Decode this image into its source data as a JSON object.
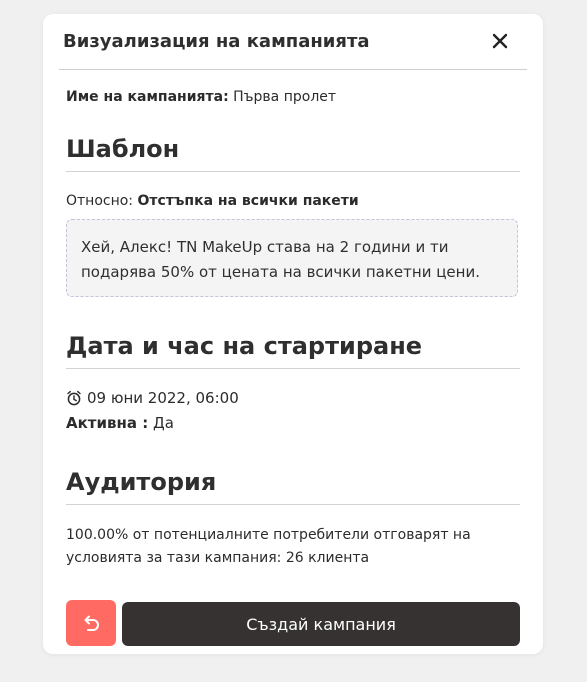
{
  "modal": {
    "title": "Визуализация на кампанията",
    "close_icon": "close-icon"
  },
  "campaign": {
    "name_label": "Име на кампанията:",
    "name_value": "Първа пролет"
  },
  "template": {
    "heading": "Шаблон",
    "about_label": "Относно:",
    "about_value": "Отстъпка на всички пакети",
    "message": "Хей, Алекс! TN MakeUp става на 2 години и ти подарява 50% от цената на всички пакетни цени."
  },
  "start": {
    "heading": "Дата и час на стартиране",
    "clock_icon": "alarm-clock-icon",
    "datetime": "09 юни 2022, 06:00",
    "active_label": "Активна :",
    "active_value": "Да"
  },
  "audience": {
    "heading": "Аудитория",
    "description": "100.00% от потенциалните потребители отговарят на условията за тази кампания: 26 клиента"
  },
  "actions": {
    "back_icon": "undo-arrow-icon",
    "create_label": "Създай кампания"
  },
  "colors": {
    "back_button": "#ff6b63",
    "create_button": "#373232",
    "template_border": "#c9c0de"
  }
}
